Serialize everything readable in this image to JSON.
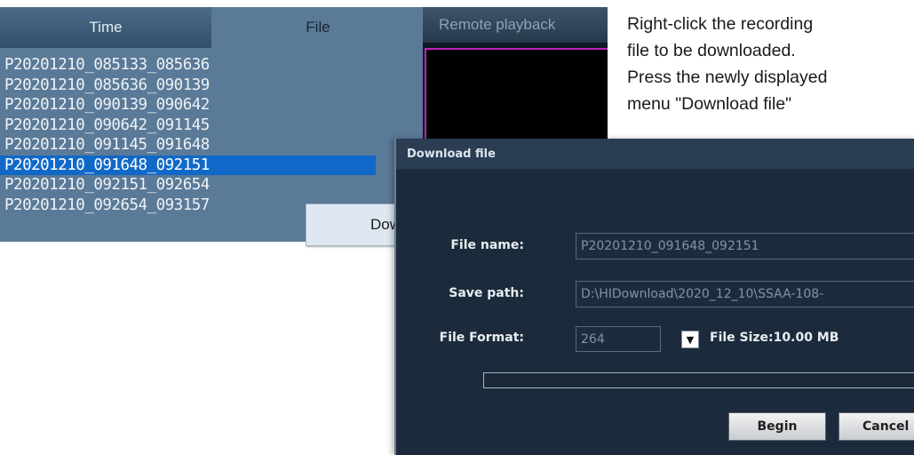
{
  "file_panel": {
    "tabs": [
      {
        "label": "Time",
        "active": false
      },
      {
        "label": "File",
        "active": true
      }
    ],
    "files": [
      "P20201210_085133_085636",
      "P20201210_085636_090139",
      "P20201210_090139_090642",
      "P20201210_090642_091145",
      "P20201210_091145_091648",
      "P20201210_091648_092151",
      "P20201210_092151_092654",
      "P20201210_092654_093157"
    ],
    "selected_file": "P20201210_091648_092151",
    "context_menu": {
      "item_label": "Download file"
    }
  },
  "playback": {
    "title": "Remote playback"
  },
  "instruction": {
    "lines": [
      "Right-click the recording",
      "file to be downloaded.",
      "Press the newly displayed",
      "menu \"Download file\""
    ]
  },
  "dialog": {
    "title": "Download file",
    "file_name_label": "File name:",
    "file_name_value": "P20201210_091648_092151",
    "save_path_label": "Save path:",
    "save_path_value": "D:\\HIDownload\\2020_12_10\\SSAA-108-",
    "file_format_label": "File Format:",
    "file_format_value": "264",
    "file_size_text": "File Size:10.00 MB",
    "progress": 0,
    "begin_label": "Begin",
    "cancel_label": "Cancel"
  },
  "colors": {
    "panel_bg": "#5b7a98",
    "selection": "#1069c9",
    "dialog_bg": "#1c2b3b",
    "video_border": "#c021c0"
  }
}
